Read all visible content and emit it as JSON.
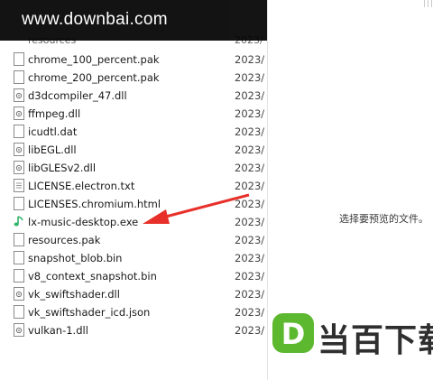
{
  "explorer": {
    "partial_top_row": {
      "name": "resources",
      "date": "2023/"
    },
    "files": [
      {
        "name": "chrome_100_percent.pak",
        "date": "2023/",
        "icon": "file-icon"
      },
      {
        "name": "chrome_200_percent.pak",
        "date": "2023/",
        "icon": "file-icon"
      },
      {
        "name": "d3dcompiler_47.dll",
        "date": "2023/",
        "icon": "dll-gear-icon"
      },
      {
        "name": "ffmpeg.dll",
        "date": "2023/",
        "icon": "dll-gear-icon"
      },
      {
        "name": "icudtl.dat",
        "date": "2023/",
        "icon": "file-icon"
      },
      {
        "name": "libEGL.dll",
        "date": "2023/",
        "icon": "dll-gear-icon"
      },
      {
        "name": "libGLESv2.dll",
        "date": "2023/",
        "icon": "dll-gear-icon"
      },
      {
        "name": "LICENSE.electron.txt",
        "date": "2023/",
        "icon": "text-file-icon"
      },
      {
        "name": "LICENSES.chromium.html",
        "date": "2023/",
        "icon": "file-icon"
      },
      {
        "name": "lx-music-desktop.exe",
        "date": "2023/",
        "icon": "music-note-icon"
      },
      {
        "name": "resources.pak",
        "date": "2023/",
        "icon": "file-icon"
      },
      {
        "name": "snapshot_blob.bin",
        "date": "2023/",
        "icon": "file-icon"
      },
      {
        "name": "v8_context_snapshot.bin",
        "date": "2023/",
        "icon": "file-icon"
      },
      {
        "name": "vk_swiftshader.dll",
        "date": "2023/",
        "icon": "dll-gear-icon"
      },
      {
        "name": "vk_swiftshader_icd.json",
        "date": "2023/",
        "icon": "file-icon"
      },
      {
        "name": "vulkan-1.dll",
        "date": "2023/",
        "icon": "dll-gear-icon"
      }
    ]
  },
  "preview_pane": {
    "hint": "选择要预览的文件。"
  },
  "watermark": {
    "text": "www.downbai.com"
  },
  "brand": {
    "badge_letter": "D",
    "text": "当百下载"
  },
  "colors": {
    "arrow": "#e8302a",
    "brand_green": "#5cb82f",
    "music_note": "#2fb36b",
    "icon_border": "#8a8a8a"
  }
}
